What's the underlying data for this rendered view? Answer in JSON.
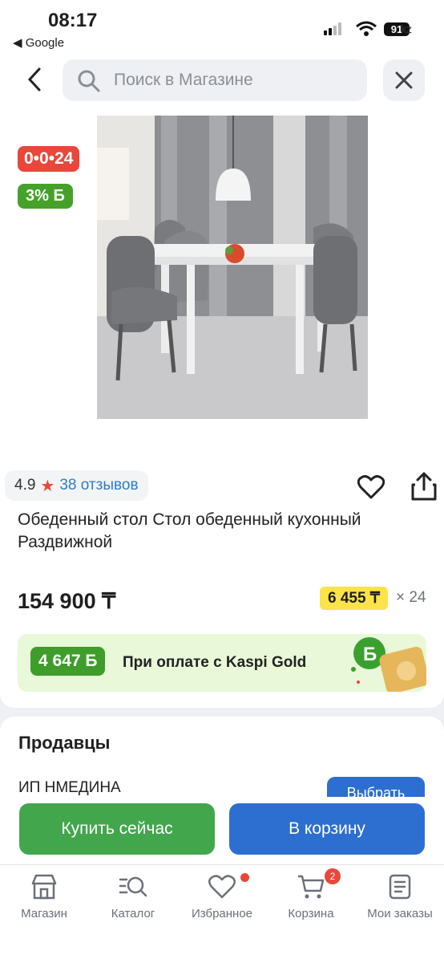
{
  "status_bar": {
    "time": "08:17",
    "back_app": "◀ Google",
    "battery": "91",
    "url_tail": "kz"
  },
  "search": {
    "placeholder": "Поиск в Магазине"
  },
  "product": {
    "badge_installment": "0•0•24",
    "badge_bonus": "3% Б",
    "rating": "4.9",
    "reviews": "38 отзывов",
    "title": "Обеденный стол Стол обеденный кухонный Раздвижной",
    "price": "154 900 ₸",
    "monthly_payment": "6 455 ₸",
    "months": "× 24"
  },
  "kaspi_gold": {
    "bonus": "4 647 Б",
    "label": "При оплате с Kaspi Gold"
  },
  "sellers": {
    "title": "Продавцы",
    "seller_name": "ИП НМЕДИНА",
    "choose_label": "Выбрать"
  },
  "actions": {
    "buy_now": "Купить сейчас",
    "to_cart": "В корзину"
  },
  "tabbar": {
    "items": [
      {
        "label": "Магазин",
        "icon": "shop-icon"
      },
      {
        "label": "Каталог",
        "icon": "catalog-search-icon"
      },
      {
        "label": "Избранное",
        "icon": "heart-icon"
      },
      {
        "label": "Корзина",
        "icon": "cart-icon",
        "badge": "2"
      },
      {
        "label": "Мои заказы",
        "icon": "orders-icon"
      }
    ]
  },
  "colors": {
    "accent_red": "#e9473a",
    "accent_green": "#42a64d",
    "accent_blue": "#2d6fd0",
    "yellow": "#fde34a"
  }
}
